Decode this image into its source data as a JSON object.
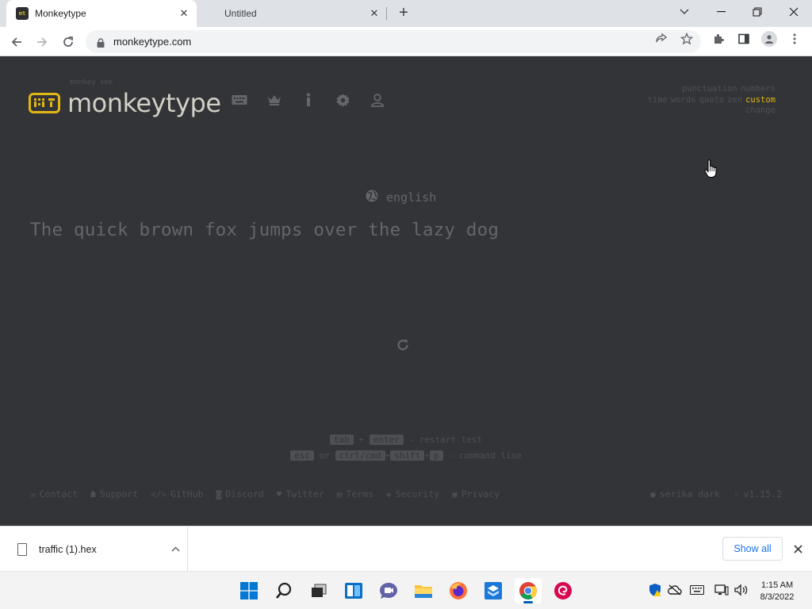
{
  "browser": {
    "tabs": [
      {
        "title": "Monkeytype",
        "active": true
      },
      {
        "title": "Untitled",
        "active": false
      }
    ],
    "address": "monkeytype.com",
    "favicon_text": "mt"
  },
  "header": {
    "logo_text": "monkeytype",
    "logo_sub": "monkey see",
    "nav": [
      "keyboard-icon",
      "crown-icon",
      "info-icon",
      "gear-icon",
      "user-icon"
    ]
  },
  "config": {
    "row1": [
      "punctuation",
      "numbers"
    ],
    "row2": [
      "time",
      "words",
      "quote",
      "zen",
      "custom"
    ],
    "row2_active": "custom",
    "row3": "change"
  },
  "test": {
    "language": "english",
    "words": "The quick brown fox jumps over the lazy dog"
  },
  "hints": {
    "line1": {
      "key1": "tab",
      "plus": "+",
      "key2": "enter",
      "action": "- restart test"
    },
    "line2": {
      "key1": "esc",
      "or": "or",
      "key2": "ctrl/cmd",
      "plus1": "+",
      "key3": "shift",
      "plus2": "+",
      "key4": "p",
      "action": "- command line"
    }
  },
  "footer": {
    "links": [
      "Contact",
      "Support",
      "GitHub",
      "Discord",
      "Twitter",
      "Terms",
      "Security",
      "Privacy"
    ],
    "theme": "serika dark",
    "version": "v1.15.2"
  },
  "downloads": {
    "file": "traffic (1).hex",
    "show_all": "Show all"
  },
  "taskbar": {
    "time": "1:15 AM",
    "date": "8/3/2022"
  },
  "colors": {
    "bg": "#323437",
    "main": "#e2b714",
    "sub": "#646669",
    "text": "#d1d0c5"
  }
}
